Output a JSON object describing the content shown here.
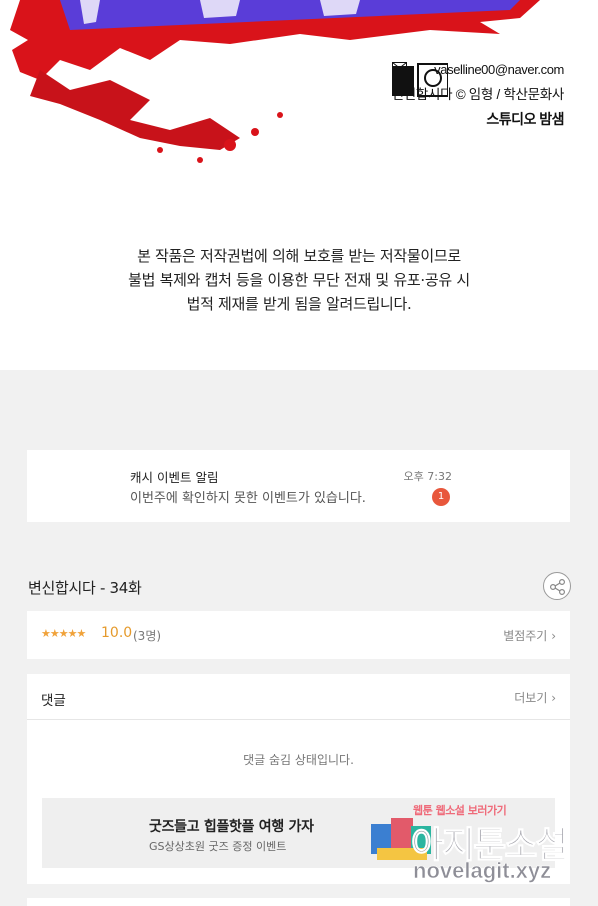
{
  "colors": {
    "accent": "#e8573c",
    "star": "#f0a23a",
    "splash": "#d9131a",
    "title_purple": "#5a3dd8"
  },
  "credits": {
    "email": "vaselline00@naver.com",
    "copyright": "변신합시다 © 임형 / 학산문화사",
    "studio_name": "스튜디오 밤샘"
  },
  "notice": {
    "lines": [
      "본 작품은 저작권법에 의해 보호를 받는 저작물이므로",
      "불법 복제와 캡처 등을 이용한 무단 전재 및 유포·공유 시",
      "법적 제재를 받게 됨을 알려드립니다."
    ]
  },
  "event": {
    "title": "캐시 이벤트 알림",
    "message": "이번주에 확인하지 못한 이벤트가 있습니다.",
    "time": "오후 7:32",
    "badge": "1"
  },
  "episode": {
    "title": "변신합시다 - 34화",
    "share_icon": "share-icon"
  },
  "rating": {
    "stars": "★★★★★",
    "score": "10.0",
    "count": "(3명)",
    "rate_label": "별점주기"
  },
  "comments": {
    "label": "댓글",
    "more_label": "더보기",
    "hidden_message": "댓글 숨김 상태입니다."
  },
  "banner": {
    "title": "굿즈들고 힙플핫플 여행 가자",
    "subtitle": "GS상상초원 굿즈 증정 이벤트"
  },
  "watermark": {
    "top": "웹툰 웹소설 보러가기",
    "big": "아지툰소설",
    "url": "novelagit.xyz"
  }
}
